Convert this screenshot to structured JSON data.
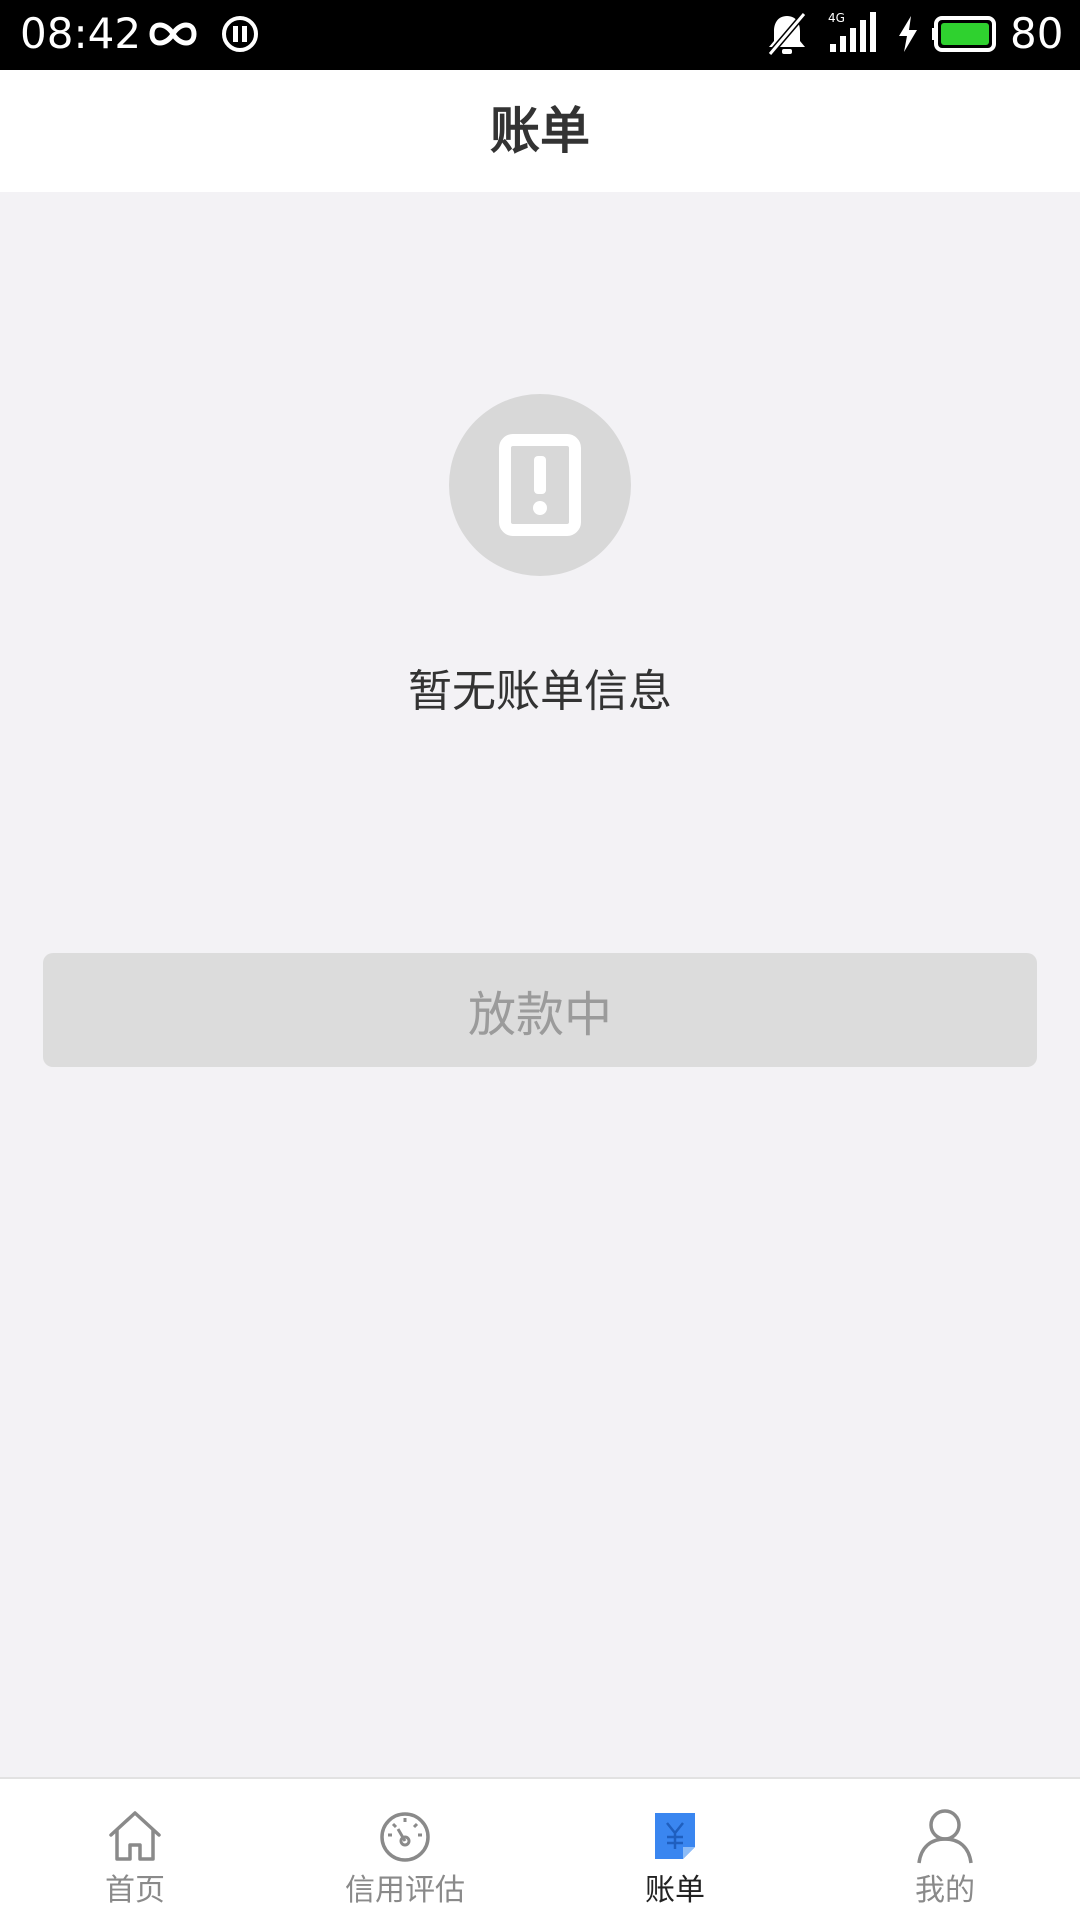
{
  "status_bar": {
    "time": "08:42",
    "signal_tag": "4G",
    "battery_level": "80",
    "icons": [
      "loop-icon",
      "pause-circle-icon",
      "bell-muted-icon",
      "signal-icon",
      "charging-bolt-icon",
      "battery-icon"
    ],
    "battery_color": "#2fd12f"
  },
  "header": {
    "title": "账单"
  },
  "empty_state": {
    "icon": "notice-icon",
    "message": "暂无账单信息"
  },
  "status_button": {
    "label": "放款中"
  },
  "tabs": [
    {
      "label": "首页",
      "icon": "home-icon",
      "active": false
    },
    {
      "label": "信用评估",
      "icon": "gauge-icon",
      "active": false
    },
    {
      "label": "账单",
      "icon": "bill-icon",
      "active": true
    },
    {
      "label": "我的",
      "icon": "user-icon",
      "active": false
    }
  ],
  "colors": {
    "accent": "#3a86f0",
    "background": "#f3f2f5",
    "button_disabled": "#dcdcdc"
  }
}
